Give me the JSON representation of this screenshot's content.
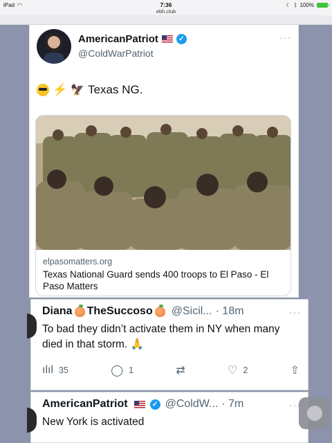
{
  "status_bar": {
    "device": "iPad",
    "time": "7:36",
    "url": "ebh.club",
    "battery": "100%"
  },
  "post": {
    "name": "AmericanPatriot",
    "handle": "@ColdWarPatriot",
    "more": "···",
    "text": "Texas NG.",
    "link": {
      "domain": "elpasomatters.org",
      "title": "Texas National Guard sends 400 troops to El Paso - El Paso Matters"
    }
  },
  "reply1": {
    "name_first": "Diana",
    "name_second": "TheSuccoso",
    "handle": "@Sicil...",
    "time": "· 18m",
    "more": "···",
    "text": "To bad they didn’t activate them in NY when many died in that storm.",
    "views": "35",
    "replies": "1",
    "likes": "2"
  },
  "reply2": {
    "name": "AmericanPatriot",
    "handle": "@ColdW...",
    "time": "· 7m",
    "more": "···",
    "text": "New York is activated"
  },
  "icons": {
    "verified": "✓",
    "views": "ılıl",
    "reply": "◯",
    "retweet": "⇄",
    "like": "♡",
    "share": "⇧",
    "pray": "🙏",
    "bolt": "⚡",
    "eagle": "🦅"
  },
  "colors": {
    "link_blue": "#1d9bf0",
    "muted": "#536471",
    "background": "#8c93ad"
  }
}
